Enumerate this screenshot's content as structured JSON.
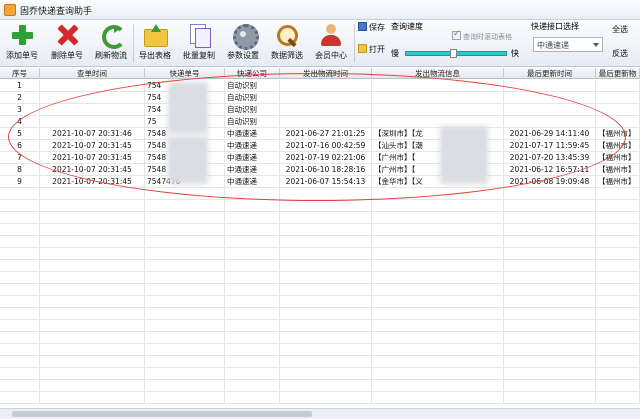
{
  "window": {
    "title": "固乔快递查询助手"
  },
  "toolbar": {
    "buttons": [
      {
        "label": "添加单号",
        "icon": "add-icon"
      },
      {
        "label": "删除单号",
        "icon": "delete-icon"
      },
      {
        "label": "刷新物流",
        "icon": "refresh-icon"
      },
      {
        "label": "导出表格",
        "icon": "export-icon"
      },
      {
        "label": "批量复制",
        "icon": "copy-icon"
      },
      {
        "label": "参数设置",
        "icon": "gear-icon"
      },
      {
        "label": "数据筛选",
        "icon": "filter-icon"
      },
      {
        "label": "会员中心",
        "icon": "member-icon"
      }
    ],
    "save_label": "保存",
    "open_label": "打开",
    "select_all_label": "全选",
    "invert_label": "反选"
  },
  "speed": {
    "title": "查询速度",
    "scroll_checkbox_label": "查询时滚动表格",
    "scroll_checked": true,
    "slow_label": "慢",
    "fast_label": "快",
    "level": 0.5
  },
  "api": {
    "title": "快递接口选择",
    "selected": "中通速递"
  },
  "table": {
    "columns": [
      "序号",
      "查单时间",
      "快递单号",
      "快递公司",
      "发出物流时间",
      "发出物流信息",
      "最后更新时间",
      "最后更新物"
    ],
    "rows": [
      {
        "no": "1",
        "query_time": "",
        "tracking": "754",
        "company": "自动识别",
        "send_time": "",
        "send_info": "",
        "last_time": "",
        "last_info": ""
      },
      {
        "no": "2",
        "query_time": "",
        "tracking": "754",
        "company": "自动识别",
        "send_time": "",
        "send_info": "",
        "last_time": "",
        "last_info": ""
      },
      {
        "no": "3",
        "query_time": "",
        "tracking": "754",
        "company": "自动识别",
        "send_time": "",
        "send_info": "",
        "last_time": "",
        "last_info": ""
      },
      {
        "no": "4",
        "query_time": "",
        "tracking": "75",
        "company": "自动识别",
        "send_time": "",
        "send_info": "",
        "last_time": "",
        "last_info": ""
      },
      {
        "no": "5",
        "query_time": "2021-10-07 20:31:46",
        "tracking": "7548",
        "company": "中通速递",
        "send_time": "2021-06-27 21:01:25",
        "send_info": "【深圳市】【龙",
        "last_time": "2021-06-29 14:11:40",
        "last_info": "【福州市】"
      },
      {
        "no": "6",
        "query_time": "2021-10-07 20:31:45",
        "tracking": "7548",
        "company": "中通速递",
        "send_time": "2021-07-16 00:42:59",
        "send_info": "【汕头市】【潮",
        "last_time": "2021-07-17 11:59:45",
        "last_info": "【福州市】"
      },
      {
        "no": "7",
        "query_time": "2021-10-07 20:31:45",
        "tracking": "7548",
        "company": "中通速递",
        "send_time": "2021-07-19 02:21:06",
        "send_info": "【广州市】【",
        "last_time": "2021-07-20 13:45:39",
        "last_info": "【福州市】"
      },
      {
        "no": "8",
        "query_time": "2021-10-07 20:31:45",
        "tracking": "7548",
        "company": "中通速递",
        "send_time": "2021-06-10 18:28:16",
        "send_info": "【广州市】【",
        "last_time": "2021-06-12 16:57:11",
        "last_info": "【福州市】"
      },
      {
        "no": "9",
        "query_time": "2021-10-07 20:31:45",
        "tracking": "7547476",
        "company": "中通速递",
        "send_time": "2021-06-07 15:54:13",
        "send_info": "【金华市】【义",
        "last_time": "2021-06-08 19:09:48",
        "last_info": "【福州市】"
      }
    ]
  },
  "colors": {
    "annotation_oval": "#e0433f",
    "slider": "#2ec6c6"
  }
}
